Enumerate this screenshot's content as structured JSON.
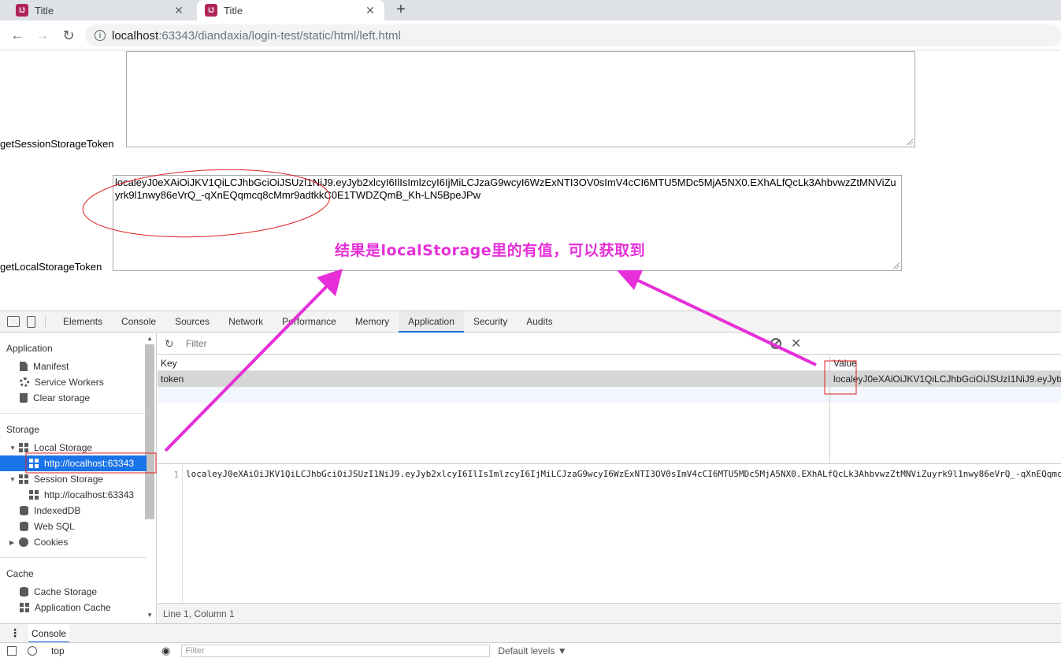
{
  "browser": {
    "tabs": [
      {
        "title": "Title",
        "active": false
      },
      {
        "title": "Title",
        "active": true
      }
    ],
    "favicon_text": "IJ",
    "close_glyph": "✕",
    "new_tab_glyph": "+",
    "back_glyph": "←",
    "forward_glyph": "→",
    "reload_glyph": "↻",
    "url_host": "localhost",
    "url_rest": ":63343/diandaxia/login-test/static/html/left.html"
  },
  "page": {
    "session_label": "getSessionStorageToken",
    "session_value": "",
    "local_label": "getLocalStorageToken",
    "local_value": "localeyJ0eXAiOiJKV1QiLCJhbGciOiJSUzI1NiJ9.eyJyb2xlcyI6IlIsImlzcyI6IjMiLCJzaG9wcyI6WzExNTI3OV0sImV4cCI6MTU5MDc5MjA5NX0.EXhALfQcLk3AhbvwzZtMNViZuyrk9l1nwy86eVrQ_-qXnEQqmcq8cMmr9adtkkC0E1TWDZQmB_Kh-LN5BpeJPw",
    "annotation": "结果是localStorage里的有值，可以获取到"
  },
  "devtools": {
    "tabs": [
      "Elements",
      "Console",
      "Sources",
      "Network",
      "Performance",
      "Memory",
      "Application",
      "Security",
      "Audits"
    ],
    "active_tab": "Application",
    "sidebar": {
      "application_head": "Application",
      "application_items": [
        "Manifest",
        "Service Workers",
        "Clear storage"
      ],
      "storage_head": "Storage",
      "local_storage": "Local Storage",
      "local_origin": "http://localhost:63343",
      "session_storage": "Session Storage",
      "session_origin": "http://localhost:63343",
      "indexeddb": "IndexedDB",
      "websql": "Web SQL",
      "cookies": "Cookies",
      "cache_head": "Cache",
      "cache_storage": "Cache Storage",
      "app_cache": "Application Cache"
    },
    "filter_placeholder": "Filter",
    "columns": {
      "key": "Key",
      "value": "Value"
    },
    "row": {
      "key": "token",
      "value": "localeyJ0eXAiOiJKV1QiLCJhbGciOiJSUzI1NiJ9.eyJyb2xlcyI6IlIsImlzcyI6IjMiLCJzaG9wcyI6WzExNTI3OV0sImV4cCI6MTU5MDc5MjA5NX0.EXhALfQcLk3AhbvwzZtMNViZuyrk9l1nwy86eVrQ_-qXnEQqmcq8cMmr9adtkkC0E1TWDZQmB_Kh-LN5BpeJPw"
    },
    "preview_line_no": "1",
    "status": "Line 1, Column 1",
    "drawer_tab": "Console",
    "console_context": "top",
    "console_filter": "Filter",
    "console_levels": "Default levels ▼"
  },
  "colors": {
    "annotation": "#e62fd8",
    "highlight_box": "#e02020",
    "selection": "#1a73e8"
  }
}
